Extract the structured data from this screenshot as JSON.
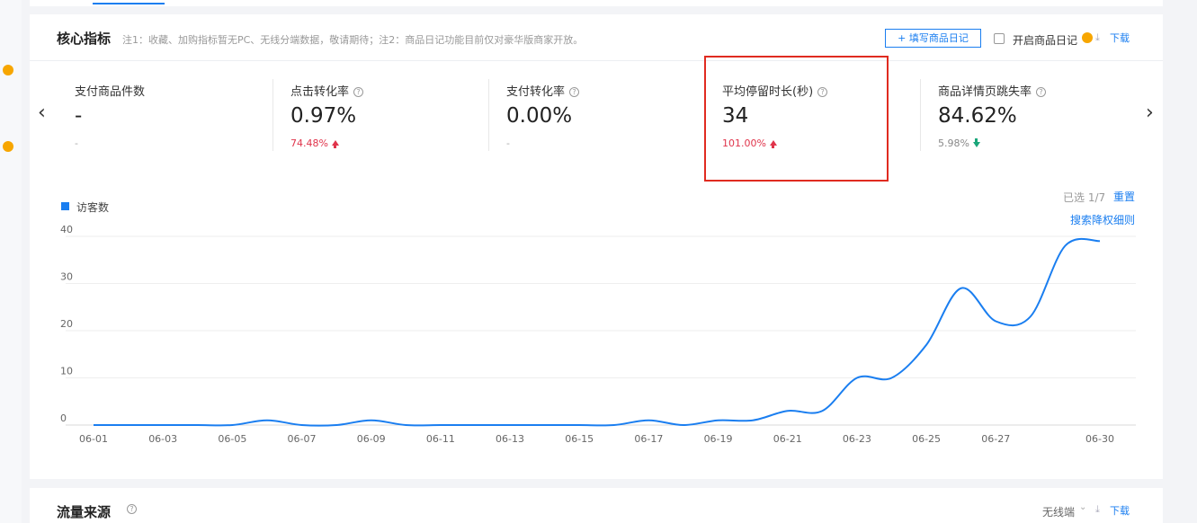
{
  "core": {
    "title": "核心指标",
    "note": "注1：收藏、加购指标暂无PC、无线分端数据，敬请期待；注2：商品日记功能目前仅对豪华版商家开放。",
    "diary_button": "+ 填写商品日记",
    "enable_diary_label": "开启商品日记",
    "download_label": "下载",
    "prev_arrow": "‹",
    "next_arrow": "›"
  },
  "metrics": [
    {
      "label": "支付商品件数",
      "has_help": false,
      "value": "-",
      "change": "-",
      "trend": "neutral"
    },
    {
      "label": "点击转化率",
      "has_help": true,
      "value": "0.97%",
      "change": "74.48%",
      "trend": "up"
    },
    {
      "label": "支付转化率",
      "has_help": true,
      "value": "0.00%",
      "change": "-",
      "trend": "neutral"
    },
    {
      "label": "平均停留时长(秒)",
      "has_help": true,
      "value": "34",
      "change": "101.00%",
      "trend": "up"
    },
    {
      "label": "商品详情页跳失率",
      "has_help": true,
      "value": "84.62%",
      "change": "5.98%",
      "trend": "down"
    }
  ],
  "chart_controls": {
    "selected": "已选 1/7",
    "reset": "重置",
    "rules": "搜索降权细则"
  },
  "chart_data": {
    "type": "line",
    "x": [
      "06-01",
      "06-02",
      "06-03",
      "06-04",
      "06-05",
      "06-06",
      "06-07",
      "06-08",
      "06-09",
      "06-10",
      "06-11",
      "06-12",
      "06-13",
      "06-14",
      "06-15",
      "06-16",
      "06-17",
      "06-18",
      "06-19",
      "06-20",
      "06-21",
      "06-22",
      "06-23",
      "06-24",
      "06-25",
      "06-26",
      "06-27",
      "06-28",
      "06-29",
      "06-30"
    ],
    "x_tick_labels": [
      "06-01",
      "06-03",
      "06-05",
      "06-07",
      "06-09",
      "06-11",
      "06-13",
      "06-15",
      "06-17",
      "06-19",
      "06-21",
      "06-23",
      "06-25",
      "06-27",
      "06-30"
    ],
    "series": [
      {
        "name": "访客数",
        "color": "#1a7ef0",
        "values": [
          0,
          0,
          0,
          0,
          0,
          1,
          0,
          0,
          1,
          0,
          0,
          0,
          0,
          0,
          0,
          0,
          1,
          0,
          1,
          1,
          3,
          3,
          10,
          10,
          17,
          29,
          22,
          23,
          38,
          39
        ]
      }
    ],
    "ylim": [
      0,
      40
    ],
    "yticks": [
      0,
      10,
      20,
      30,
      40
    ],
    "grid": true,
    "legend": "top-left"
  },
  "traffic": {
    "title": "流量来源",
    "select_value": "无线端",
    "download_label": "下载"
  },
  "colors": {
    "accent": "#1a7ef0",
    "up": "#e0344b",
    "down": "#1aa67a",
    "highlight_box": "#e02b20",
    "badge": "#f7a600"
  }
}
